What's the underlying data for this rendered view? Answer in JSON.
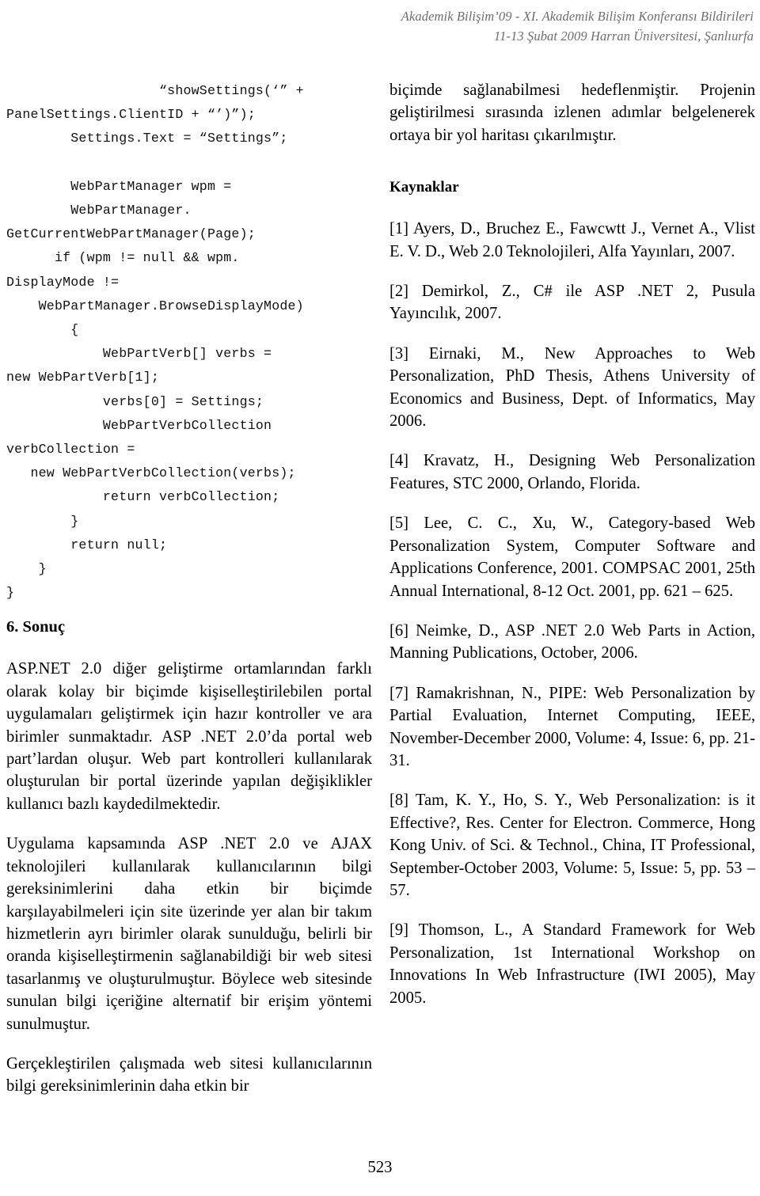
{
  "header": {
    "line1": "Akademik Bilişim’09 - XI. Akademik Bilişim Konferansı Bildirileri",
    "line2": "11-13 Şubat 2009 Harran Üniversitesi, Şanlıurfa"
  },
  "left_column": {
    "code_lines": [
      "                   “showSettings(‘” +",
      "PanelSettings.ClientID + “’)”);",
      "        Settings.Text = “Settings”;",
      "",
      "        WebPartManager wpm =",
      "        WebPartManager.",
      "GetCurrentWebPartManager(Page);",
      "      if (wpm != null && wpm.",
      "DisplayMode !=",
      "    WebPartManager.BrowseDisplayMode)",
      "        {",
      "            WebPartVerb[] verbs =",
      "new WebPartVerb[1];",
      "            verbs[0] = Settings;",
      "            WebPartVerbCollection",
      "verbCollection =",
      "   new WebPartVerbCollection(verbs);",
      "            return verbCollection;",
      "        }",
      "        return null;",
      "    }",
      "}"
    ],
    "section_heading": "6. Sonuç",
    "paragraphs": [
      "ASP.NET 2.0 diğer geliştirme ortamlarından farklı olarak kolay bir biçimde kişiselleştirilebilen portal uygulamaları geliştirmek için hazır kontroller ve ara birimler sunmaktadır. ASP .NET 2.0’da portal web part’lardan oluşur. Web part kontrolleri kullanılarak oluşturulan bir portal üzerinde yapılan değişiklikler kullanıcı bazlı kaydedilmektedir.",
      "Uygulama kapsamında ASP .NET 2.0 ve AJAX teknolojileri kullanılarak kullanıcılarının bilgi gereksinimlerini daha etkin bir biçimde karşılayabilmeleri için site üzerinde yer alan bir takım hizmetlerin ayrı birimler olarak sunulduğu, belirli bir oranda kişiselleştirmenin sağlanabildiği bir web sitesi tasarlanmış ve oluşturulmuştur. Böylece web sitesinde sunulan bilgi içeriğine alternatif bir erişim yöntemi sunulmuştur.",
      "Gerçekleştirilen çalışmada web sitesi kullanıcılarının bilgi gereksinimlerinin daha etkin bir"
    ]
  },
  "right_column": {
    "continuation_paragraph": "biçimde sağlanabilmesi hedeflenmiştir. Projenin geliştirilmesi sırasında izlenen adımlar belgelenerek ortaya bir yol haritası çıkarılmıştır.",
    "references_heading": "Kaynaklar",
    "references": [
      "[1]  Ayers, D., Bruchez E., Fawcwtt J., Vernet A., Vlist E. V. D., Web 2.0 Teknolojileri, Alfa Yayınları, 2007.",
      "[2]  Demirkol, Z., C# ile ASP .NET 2, Pusula Yayıncılık, 2007.",
      "[3]  Eirnaki, M., New Approaches to Web Personalization, PhD Thesis, Athens University of Economics and Business, Dept. of Informatics, May 2006.",
      "[4]  Kravatz, H., Designing Web Personalization Features, STC 2000, Orlando, Florida.",
      "[5]  Lee, C. C., Xu, W., Category-based Web Personalization System, Computer Software and Applications Conference, 2001. COMPSAC 2001, 25th Annual International, 8-12 Oct. 2001, pp. 621 – 625.",
      "[6]  Neimke, D., ASP .NET 2.0 Web Parts in Action, Manning Publications, October, 2006.",
      "[7]  Ramakrishnan, N., PIPE: Web Personalization by Partial Evaluation, Internet Computing, IEEE, November-December 2000, Volume: 4, Issue: 6, pp. 21-31.",
      "[8]  Tam, K. Y., Ho, S. Y., Web Personalization: is it Effective?, Res. Center for Electron. Commerce, Hong Kong Univ. of Sci. & Technol., China, IT Professional, September-October 2003, Volume: 5, Issue: 5, pp. 53 – 57.",
      "[9]  Thomson, L., A Standard Framework for Web Personalization, 1st International Workshop on Innovations In Web Infrastructure (IWI 2005), May 2005."
    ]
  },
  "footer": {
    "page_number": "523"
  }
}
